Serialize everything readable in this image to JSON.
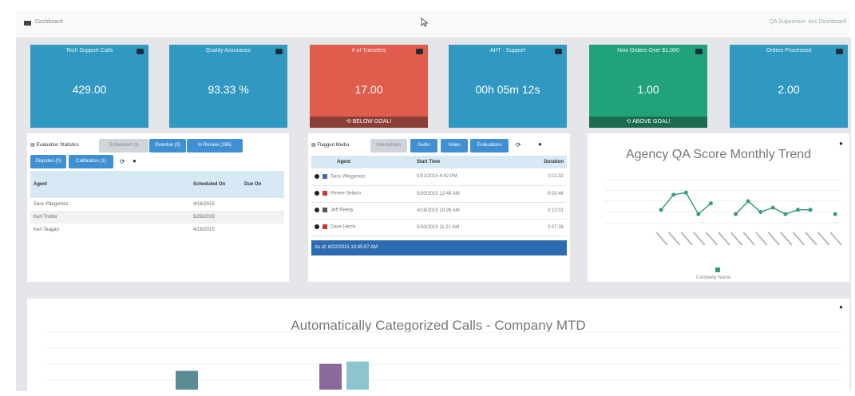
{
  "kpis": [
    {
      "label": "Tech Support Calls",
      "value": "429.00",
      "color": "blue",
      "goal": ""
    },
    {
      "label": "Quality Assurance",
      "value": "93.33 %",
      "color": "blue",
      "goal": ""
    },
    {
      "label": "# of Transfers",
      "value": "17.00",
      "color": "red",
      "goal": "BELOW GOAL!"
    },
    {
      "label": "AHT - Support",
      "value": "00h 05m 12s",
      "color": "blue",
      "goal": ""
    },
    {
      "label": "New Orders Over $1,000",
      "value": "1.00",
      "color": "green",
      "goal": "ABOVE GOAL!"
    },
    {
      "label": "Orders Processed",
      "value": "2.00",
      "color": "blue",
      "goal": ""
    }
  ],
  "evaluation": {
    "title": "Evaluation Statistics",
    "tabs": [
      "Scheduled (3)",
      "Overdue (3)",
      "In Review (285)",
      "Disputes (0)",
      "Calibration (1)"
    ],
    "headers": [
      "Agent",
      "Scheduled On",
      "Due On"
    ],
    "rows": [
      {
        "agent": "Sara Villagomez",
        "scheduled": "4/16/2015",
        "due": ""
      },
      {
        "agent": "Kurt Trotter",
        "scheduled": "5/29/2015",
        "due": ""
      },
      {
        "agent": "Ken Teagan",
        "scheduled": "4/16/2015",
        "due": ""
      }
    ]
  },
  "flagged": {
    "title": "Flagged Media",
    "tabs": [
      "Interactions",
      "Audio",
      "Video",
      "Evaluations"
    ],
    "headers": [
      "Agent",
      "Start Time",
      "Duration"
    ],
    "rows": [
      {
        "agent": "Sara Villagomez",
        "start": "5/31/2015 4:42 PM",
        "duration": "0:11:32"
      },
      {
        "agent": "Renee Selano",
        "start": "5/30/2015 12:49 AM",
        "duration": "0:03:46"
      },
      {
        "agent": "Jeff Reedy",
        "start": "4/16/2015 10:26 AM",
        "duration": "0:12:01"
      },
      {
        "agent": "Dave Harris",
        "start": "5/30/2015 11:21 AM",
        "duration": "0:07:26"
      }
    ],
    "as_of": "As of: 6/22/2015 10:45:07 AM"
  },
  "qa_chart_title": "Agency QA Score Monthly Trend",
  "qa_legend": "Company Name",
  "calls_chart_title": "Automatically Categorized Calls - Company MTD",
  "user_link": "QA Supervisor: Acc Dashboard",
  "crumb": "Dashboard",
  "colors": {
    "blue": "#3198c1",
    "red": "#e05c4d",
    "green": "#22a27a",
    "tab": "#3f8fd3",
    "line": "#3a9d7a"
  },
  "chart_data": [
    {
      "type": "line",
      "title": "Agency QA Score Monthly Trend",
      "series": [
        {
          "name": "Company Name",
          "values": [
            null,
            null,
            null,
            null,
            0.6,
            1.3,
            1.4,
            0.4,
            0.9,
            null,
            0.4,
            1.0,
            0.5,
            0.7,
            0.4,
            0.6,
            0.6,
            null,
            0.4
          ]
        }
      ],
      "categories": [
        "",
        "",
        "",
        "",
        "",
        "",
        "",
        "",
        "",
        "",
        "",
        "",
        "",
        "",
        "",
        "",
        "",
        "",
        ""
      ],
      "ylim": [
        0,
        2
      ]
    },
    {
      "type": "bar",
      "title": "Automatically Categorized Calls - Company MTD",
      "categories": [
        "",
        "",
        ""
      ],
      "series": [
        {
          "values": [
            80,
            110,
            120
          ]
        }
      ],
      "colors": [
        "#5a8c96",
        "#8a6a9a",
        "#8cc5d0"
      ]
    }
  ]
}
